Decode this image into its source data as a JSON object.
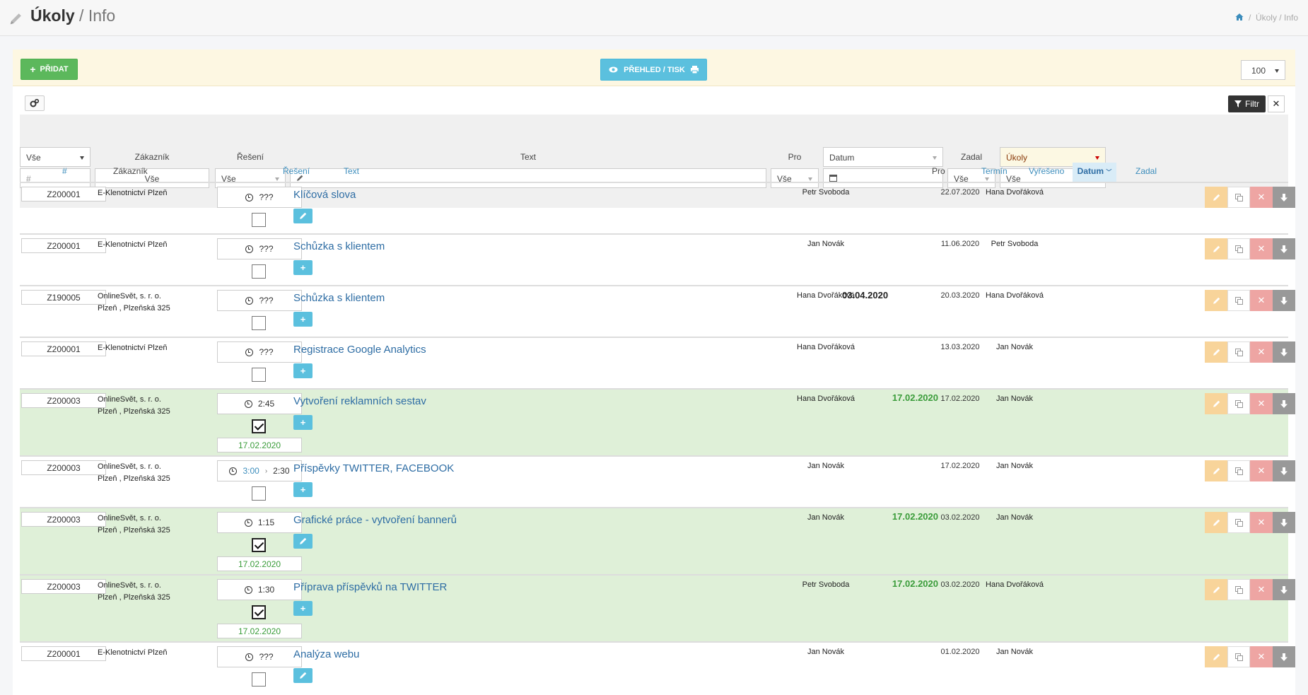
{
  "header": {
    "title": "Úkoly",
    "subtitle": "Info",
    "breadcrumb": [
      "Úkoly",
      "Info"
    ]
  },
  "toolbar": {
    "add_label": "PŘIDAT",
    "print_label": "PŘEHLED / TISK",
    "page_size": "100",
    "filter_label": "Filtr"
  },
  "filters": {
    "status_select": "Vše",
    "zakaznik_label": "Zákazník",
    "reseni_label": "Řešení",
    "text_label": "Text",
    "pro_label": "Pro",
    "datum_select": "Datum",
    "zadal_label": "Zadal",
    "type_select": "Úkoly",
    "code_placeholder": "#",
    "zakaznik_value": "Vše",
    "reseni_value": "Vše",
    "pro_value": "Vše",
    "zadal_value": "Vše",
    "type_value": "Vše"
  },
  "columns": {
    "num": "#",
    "zakaznik": "Zákazník",
    "reseni": "Řešení",
    "text": "Text",
    "pro": "Pro",
    "termin": "Termín",
    "vyreseno": "Vyřešeno",
    "datum": "Datum",
    "zadal": "Zadal"
  },
  "rows": [
    {
      "code": "Z200001",
      "cust1": "E-Klenotnictví Plzeň",
      "cust2": "",
      "time": "???",
      "plan": "",
      "done": false,
      "done_date": "",
      "task": "Klíčová slova",
      "btn": "edit",
      "pro": "Petr Svoboda",
      "termin": "",
      "vyreseno": "",
      "datum": "22.07.2020",
      "zadal": "Hana Dvořáková"
    },
    {
      "code": "Z200001",
      "cust1": "E-Klenotnictví Plzeň",
      "cust2": "",
      "time": "???",
      "plan": "",
      "done": false,
      "done_date": "",
      "task": "Schůzka s klientem",
      "btn": "add",
      "pro": "Jan Novák",
      "termin": "",
      "vyreseno": "",
      "datum": "11.06.2020",
      "zadal": "Petr Svoboda"
    },
    {
      "code": "Z190005",
      "cust1": "OnlineSvět, s. r. o.",
      "cust2": "Plzeň , Plzeňská 325",
      "time": "???",
      "plan": "",
      "done": false,
      "done_date": "",
      "task": "Schůzka s klientem",
      "btn": "add",
      "pro": "Hana Dvořáková",
      "termin": "03.04.2020",
      "vyreseno": "",
      "datum": "20.03.2020",
      "zadal": "Hana Dvořáková"
    },
    {
      "code": "Z200001",
      "cust1": "E-Klenotnictví Plzeň",
      "cust2": "",
      "time": "???",
      "plan": "",
      "done": false,
      "done_date": "",
      "task": "Registrace Google Analytics",
      "btn": "add",
      "pro": "Hana Dvořáková",
      "termin": "",
      "vyreseno": "",
      "datum": "13.03.2020",
      "zadal": "Jan Novák"
    },
    {
      "code": "Z200003",
      "cust1": "OnlineSvět, s. r. o.",
      "cust2": "Plzeň , Plzeňská 325",
      "time": "2:45",
      "plan": "",
      "done": true,
      "done_date": "17.02.2020",
      "task": "Vytvoření reklamních sestav",
      "btn": "add",
      "pro": "Hana Dvořáková",
      "termin": "",
      "vyreseno": "17.02.2020",
      "datum": "17.02.2020",
      "zadal": "Jan Novák"
    },
    {
      "code": "Z200003",
      "cust1": "OnlineSvět, s. r. o.",
      "cust2": "Plzeň , Plzeňská 325",
      "time": "2:30",
      "plan": "3:00",
      "done": false,
      "done_date": "",
      "task": "Příspěvky TWITTER, FACEBOOK",
      "btn": "add",
      "pro": "Jan Novák",
      "termin": "",
      "vyreseno": "",
      "datum": "17.02.2020",
      "zadal": "Jan Novák"
    },
    {
      "code": "Z200003",
      "cust1": "OnlineSvět, s. r. o.",
      "cust2": "Plzeň , Plzeňská 325",
      "time": "1:15",
      "plan": "",
      "done": true,
      "done_date": "17.02.2020",
      "task": "Grafické práce - vytvoření bannerů",
      "btn": "edit",
      "pro": "Jan Novák",
      "termin": "",
      "vyreseno": "17.02.2020",
      "datum": "03.02.2020",
      "zadal": "Jan Novák"
    },
    {
      "code": "Z200003",
      "cust1": "OnlineSvět, s. r. o.",
      "cust2": "Plzeň , Plzeňská 325",
      "time": "1:30",
      "plan": "",
      "done": true,
      "done_date": "17.02.2020",
      "task": "Příprava příspěvků na TWITTER",
      "btn": "add",
      "pro": "Petr Svoboda",
      "termin": "",
      "vyreseno": "17.02.2020",
      "datum": "03.02.2020",
      "zadal": "Hana Dvořáková"
    },
    {
      "code": "Z200001",
      "cust1": "E-Klenotnictví Plzeň",
      "cust2": "",
      "time": "???",
      "plan": "",
      "done": false,
      "done_date": "",
      "task": "Analýza webu",
      "btn": "edit",
      "pro": "Jan Novák",
      "termin": "",
      "vyreseno": "",
      "datum": "01.02.2020",
      "zadal": "Jan Novák"
    }
  ]
}
